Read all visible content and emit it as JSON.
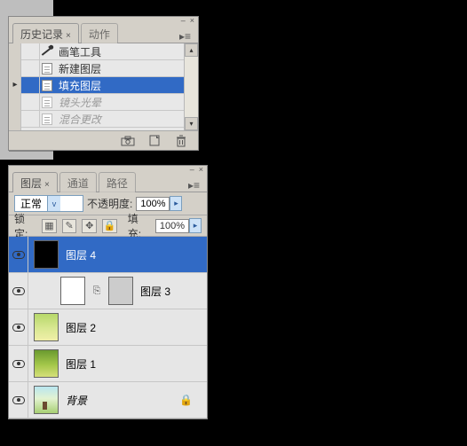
{
  "history_panel": {
    "tabs": {
      "history": "历史记录",
      "actions": "动作"
    },
    "items": [
      {
        "label": "画笔工具",
        "icon": "brush",
        "selected": false,
        "dim": false
      },
      {
        "label": "新建图层",
        "icon": "doc",
        "selected": false,
        "dim": false
      },
      {
        "label": "填充图层",
        "icon": "doc",
        "selected": true,
        "dim": false
      },
      {
        "label": "镜头光晕",
        "icon": "doc",
        "selected": false,
        "dim": true
      },
      {
        "label": "混合更改",
        "icon": "doc",
        "selected": false,
        "dim": true
      }
    ],
    "footer_icons": [
      "snapshot",
      "new",
      "trash"
    ]
  },
  "layers_panel": {
    "tabs": {
      "layers": "图层",
      "channels": "通道",
      "paths": "路径"
    },
    "blend_mode": "正常",
    "opacity_label": "不透明度:",
    "opacity_value": "100%",
    "lock_label": "锁定:",
    "fill_label": "填充:",
    "fill_value": "100%",
    "layers": [
      {
        "name": "图层 4",
        "visible": true,
        "thumb": "black",
        "selected": true
      },
      {
        "name": "图层 3",
        "visible": true,
        "thumb": "white",
        "mask": true
      },
      {
        "name": "图层 2",
        "visible": true,
        "thumb": "grad1"
      },
      {
        "name": "图层 1",
        "visible": true,
        "thumb": "grad2"
      },
      {
        "name": "背景",
        "visible": true,
        "thumb": "photo",
        "locked": true,
        "bg": true
      }
    ]
  }
}
